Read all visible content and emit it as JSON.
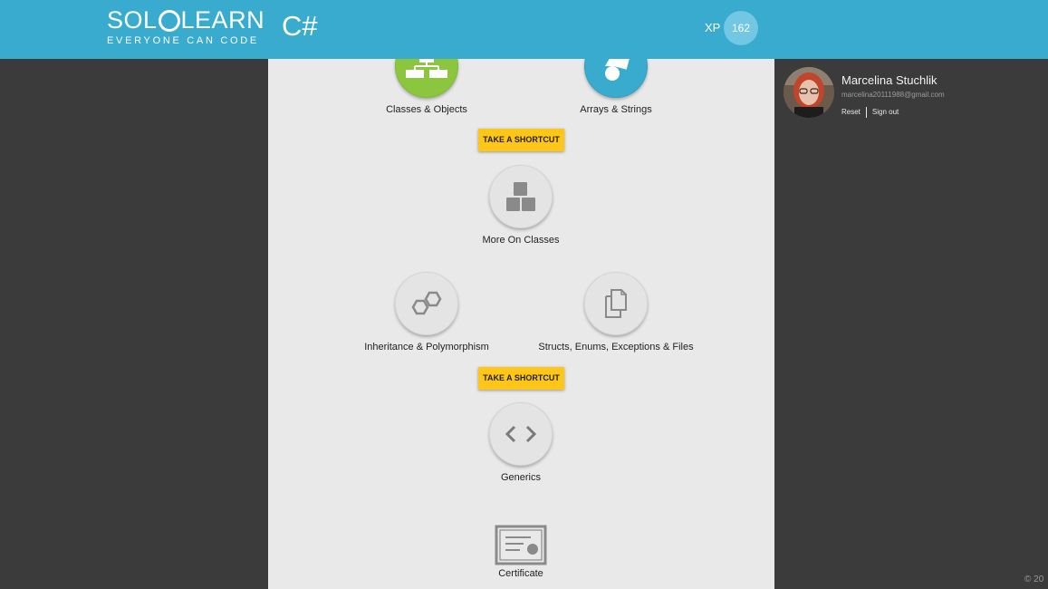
{
  "header": {
    "logo_part1": "SOL",
    "logo_part2": "LEARN",
    "tagline": "EVERYONE CAN CODE",
    "course_title": "C#",
    "xp_label": "XP",
    "xp_value": "162"
  },
  "course": {
    "nodes": [
      {
        "label": "Classes & Objects",
        "icon": "class-diagram-icon",
        "color": "#8cc63f"
      },
      {
        "label": "Arrays & Strings",
        "icon": "shapes-icon",
        "color": "#38abcf"
      },
      {
        "label": "More On Classes",
        "icon": "stacked-boxes-icon"
      },
      {
        "label": "Inheritance & Polymorphism",
        "icon": "hexagons-icon"
      },
      {
        "label": "Structs, Enums, Exceptions & Files",
        "icon": "files-icon"
      },
      {
        "label": "Generics",
        "icon": "code-brackets-icon"
      }
    ],
    "shortcut_label": "TAKE A SHORTCUT",
    "certificate_label": "Certificate"
  },
  "user": {
    "name": "Marcelina Stuchlik",
    "email": "marcelina20111988@gmail.com",
    "reset_label": "Reset",
    "signout_label": "Sign out"
  },
  "footer": {
    "copyright": "© 20"
  },
  "colors": {
    "header": "#38abcf",
    "shortcut": "#ffc61a",
    "completed_green": "#8cc63f",
    "completed_blue": "#38abcf"
  }
}
